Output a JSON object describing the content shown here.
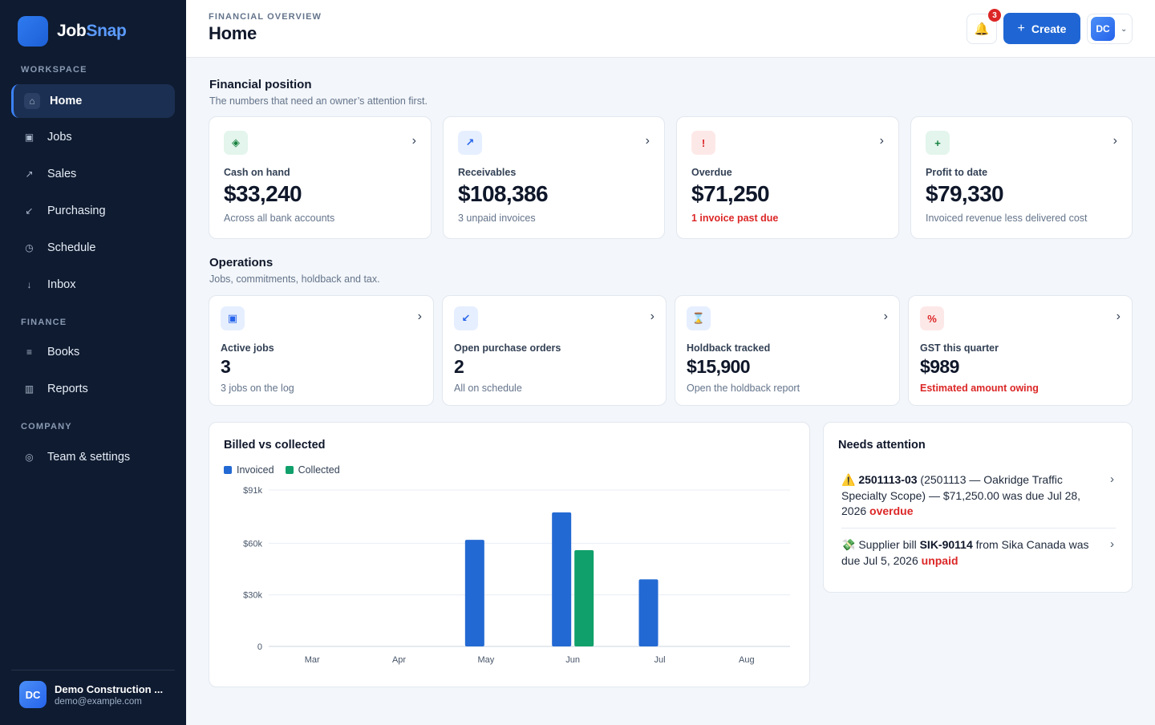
{
  "brand": {
    "name_part1": "Job",
    "name_part2": "Snap"
  },
  "sidebar": {
    "sections": {
      "workspace": "WORKSPACE",
      "finance": "FINANCE",
      "company": "COMPANY"
    },
    "items": [
      {
        "label": "Home",
        "icon": "home-icon",
        "glyph": "⌂"
      },
      {
        "label": "Jobs",
        "icon": "jobs-icon",
        "glyph": "▣"
      },
      {
        "label": "Sales",
        "icon": "sales-icon",
        "glyph": "↗"
      },
      {
        "label": "Purchasing",
        "icon": "purchasing-icon",
        "glyph": "↙"
      },
      {
        "label": "Schedule",
        "icon": "clock-icon",
        "glyph": "◷"
      },
      {
        "label": "Inbox",
        "icon": "inbox-icon",
        "glyph": "↓"
      },
      {
        "label": "Books",
        "icon": "books-icon",
        "glyph": "≡"
      },
      {
        "label": "Reports",
        "icon": "reports-icon",
        "glyph": "▥"
      },
      {
        "label": "Team & settings",
        "icon": "settings-icon",
        "glyph": "◎"
      }
    ],
    "account": {
      "initials": "DC",
      "name": "Demo Construction ...",
      "email": "demo@example.com"
    }
  },
  "header": {
    "eyebrow": "FINANCIAL OVERVIEW",
    "title": "Home",
    "notifications": "3",
    "bell_glyph": "🔔",
    "create_label": "Create",
    "user_initials": "DC"
  },
  "financial": {
    "title": "Financial position",
    "subtitle": "The numbers that need an owner’s attention first.",
    "cards": [
      {
        "label": "Cash on hand",
        "value": "$33,240",
        "note": "Across all bank accounts",
        "glyph": "◈",
        "icon_bg": "#e3f5ec",
        "icon_color": "#15803d"
      },
      {
        "label": "Receivables",
        "value": "$108,386",
        "note": "3 unpaid invoices",
        "glyph": "↗",
        "icon_bg": "#e6efff",
        "icon_color": "#2563eb"
      },
      {
        "label": "Overdue",
        "value": "$71,250",
        "note": "1 invoice past due",
        "glyph": "!",
        "icon_bg": "#fde8e8",
        "icon_color": "#dc2626"
      },
      {
        "label": "Profit to date",
        "value": "$79,330",
        "note": "Invoiced revenue less delivered cost",
        "glyph": "+",
        "icon_bg": "#e3f5ec",
        "icon_color": "#15803d"
      }
    ]
  },
  "operations": {
    "title": "Operations",
    "subtitle": "Jobs, commitments, holdback and tax.",
    "cards": [
      {
        "label": "Active jobs",
        "value": "3",
        "note": "3 jobs on the log",
        "glyph": "▣",
        "icon_bg": "#e6efff",
        "icon_color": "#2563eb"
      },
      {
        "label": "Open purchase orders",
        "value": "2",
        "note": "All on schedule",
        "glyph": "↙",
        "icon_bg": "#e6efff",
        "icon_color": "#2563eb"
      },
      {
        "label": "Holdback tracked",
        "value": "$15,900",
        "note": "Open the holdback report",
        "glyph": "⌛",
        "icon_bg": "#e6efff",
        "icon_color": "#2563eb"
      },
      {
        "label": "GST this quarter",
        "value": "$989",
        "note": "Estimated amount owing",
        "glyph": "%",
        "icon_bg": "#fde8e8",
        "icon_color": "#dc2626"
      }
    ]
  },
  "chart_panel": {
    "title": "Billed vs collected"
  },
  "chart_data": {
    "type": "bar",
    "categories": [
      "Mar",
      "Apr",
      "May",
      "Jun",
      "Jul",
      "Aug"
    ],
    "series": [
      {
        "name": "Invoiced",
        "color": "#2369d3",
        "values": [
          0,
          0,
          62000,
          78000,
          39000,
          0
        ]
      },
      {
        "name": "Collected",
        "color": "#10a06b",
        "values": [
          0,
          0,
          0,
          56000,
          0,
          0
        ]
      }
    ],
    "yticks": [
      {
        "value": 0,
        "label": "0"
      },
      {
        "value": 30000,
        "label": "$30k"
      },
      {
        "value": 60000,
        "label": "$60k"
      },
      {
        "value": 91000,
        "label": "$91k"
      }
    ],
    "ylim": [
      0,
      91000
    ],
    "grid": true,
    "legend": "top-left"
  },
  "attention": {
    "title": "Needs attention",
    "items": [
      {
        "emoji": "⚠️",
        "ref": "2501113-03",
        "text": " (2501113 — Oakridge Traffic Specialty Scope) — $71,250.00 was due Jul 28, 2026 ",
        "status": "overdue"
      },
      {
        "emoji": "💸",
        "prefix": " Supplier bill ",
        "ref": "SIK-90114",
        "text": " from Sika Canada was due Jul 5, 2026 ",
        "status": "unpaid"
      }
    ]
  }
}
